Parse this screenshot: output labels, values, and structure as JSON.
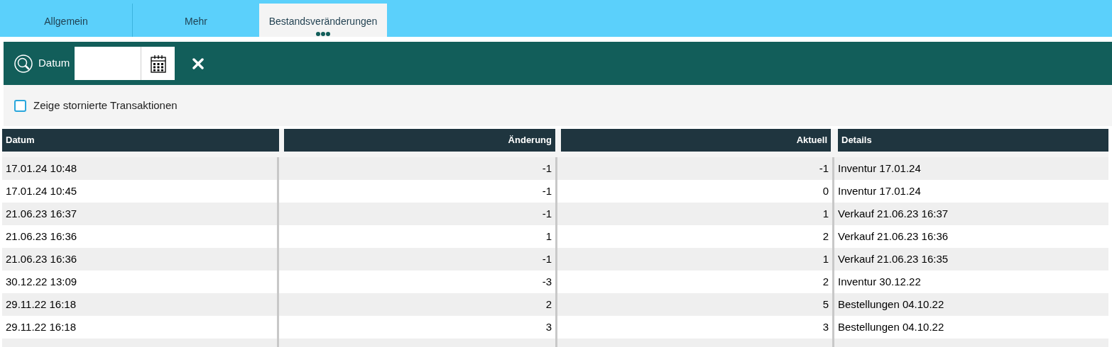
{
  "tabs": [
    {
      "label": "Allgemein",
      "selected": false
    },
    {
      "label": "Mehr",
      "selected": false
    },
    {
      "label": "Bestandsveränderungen",
      "selected": true
    }
  ],
  "filter": {
    "label": "Datum"
  },
  "show_cancelled": {
    "label": "Zeige stornierte Transaktionen",
    "checked": false
  },
  "table": {
    "columns": [
      "Datum",
      "Änderung",
      "Aktuell",
      "Details"
    ],
    "rows": [
      [
        "17.01.24 10:48",
        "-1",
        "-1",
        "Inventur 17.01.24"
      ],
      [
        "17.01.24 10:45",
        "-1",
        "0",
        "Inventur 17.01.24"
      ],
      [
        "21.06.23 16:37",
        "-1",
        "1",
        "Verkauf 21.06.23 16:37"
      ],
      [
        "21.06.23 16:36",
        "1",
        "2",
        "Verkauf 21.06.23 16:36"
      ],
      [
        "21.06.23 16:36",
        "-1",
        "1",
        "Verkauf 21.06.23 16:35"
      ],
      [
        "30.12.22 13:09",
        "-3",
        "2",
        "Inventur 30.12.22"
      ],
      [
        "29.11.22 16:18",
        "2",
        "5",
        "Bestellungen 04.10.22"
      ],
      [
        "29.11.22 16:18",
        "3",
        "3",
        "Bestellungen 04.10.22"
      ]
    ]
  }
}
